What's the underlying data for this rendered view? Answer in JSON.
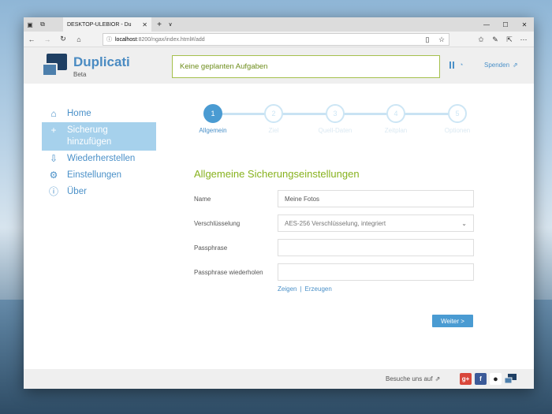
{
  "browser": {
    "tab_title": "DESKTOP-ULEBIOR - Du",
    "url_host": "localhost",
    "url_path": ":8200/ngax/index.html#/add"
  },
  "app": {
    "name": "Duplicati",
    "edition": "Beta",
    "status": "Keine geplanten Aufgaben",
    "donate": "Spenden"
  },
  "sidebar": {
    "items": [
      {
        "label": "Home",
        "icon": "home-icon"
      },
      {
        "label": "Sicherung hinzufügen",
        "icon": "plus-icon",
        "active": true
      },
      {
        "label": "Wiederherstellen",
        "icon": "restore-icon"
      },
      {
        "label": "Einstellungen",
        "icon": "gear-icon"
      },
      {
        "label": "Über",
        "icon": "info-icon"
      }
    ]
  },
  "steps": [
    {
      "num": "1",
      "label": "Allgemein",
      "active": true
    },
    {
      "num": "2",
      "label": "Ziel"
    },
    {
      "num": "3",
      "label": "Quell-Daten"
    },
    {
      "num": "4",
      "label": "Zeitplan"
    },
    {
      "num": "5",
      "label": "Optionen"
    }
  ],
  "form": {
    "title": "Allgemeine Sicherungseinstellungen",
    "name_label": "Name",
    "name_value": "Meine Fotos",
    "encryption_label": "Verschlüsselung",
    "encryption_value": "AES-256 Verschlüsselung, integriert",
    "passphrase_label": "Passphrase",
    "passphrase_value": "",
    "repeat_label": "Passphrase wiederholen",
    "repeat_value": "",
    "show_link": "Zeigen",
    "link_sep": "|",
    "generate_link": "Erzeugen",
    "next_button": "Weiter >"
  },
  "footer": {
    "visit": "Besuche uns auf"
  },
  "colors": {
    "accent": "#4a90c8",
    "status_green": "#87b21e",
    "sidebar_active": "#a6d1ec"
  }
}
